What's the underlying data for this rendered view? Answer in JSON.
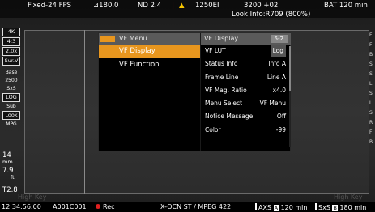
{
  "topbar": {
    "fps": "Fixed-24 FPS",
    "shutter": "⊿180.0",
    "nd": "ND 2.4",
    "warn_bar": "|",
    "warn_icon": "▲",
    "ei": "1250EI",
    "wb": "3200 +02",
    "battery": "BAT 120 min",
    "look_info": "Look Info:R709 (800%)"
  },
  "leftcol": {
    "badges": [
      "4K",
      "4:3",
      "2.0x",
      "Sur.V",
      "Base",
      "2500",
      "SxS",
      "LOG",
      "Sub",
      "Look",
      "MPG"
    ],
    "focal_value": "14",
    "focal_unit": "mm",
    "distance_value": "7.9",
    "distance_unit": "ft",
    "iris": "T2.8",
    "high_key_left": "High Key"
  },
  "rightcol": {
    "labels": [
      "F",
      "F",
      "B",
      "S",
      "S",
      "L",
      "S",
      "L",
      "S",
      "R",
      "F",
      "R"
    ]
  },
  "menu": {
    "left_header": "VF Menu",
    "left_items": [
      {
        "label": "VF Display",
        "selected": true
      },
      {
        "label": "VF Function",
        "selected": false
      }
    ],
    "right_header": "VF Display",
    "page_indicator": "5-2",
    "rows": [
      {
        "label": "VF LUT",
        "value": "Log"
      },
      {
        "label": "Status Info",
        "value": "Info A"
      },
      {
        "label": "Frame Line",
        "value": "Line A"
      },
      {
        "label": "VF Mag. Ratio",
        "value": "x4.0"
      },
      {
        "label": "Menu Select",
        "value": "VF Menu"
      },
      {
        "label": "Notice Message",
        "value": "Off"
      },
      {
        "label": "Color",
        "value": "-99"
      }
    ]
  },
  "high_key_right": "High Key",
  "bottombar": {
    "timecode": "12:34:56:00",
    "clip": "A001C001",
    "rec": "Rec",
    "codec": "X-OCN ST / MPEG 422",
    "axs_label": "AXS",
    "axs_slot": "A",
    "axs_remaining": "120 min",
    "sxs_label": "SxS",
    "sxs_slot": "B",
    "sxs_remaining": "180 min"
  },
  "colors": {
    "accent": "#e8961e",
    "warning": "#f5c400",
    "record": "#e01f1f"
  }
}
